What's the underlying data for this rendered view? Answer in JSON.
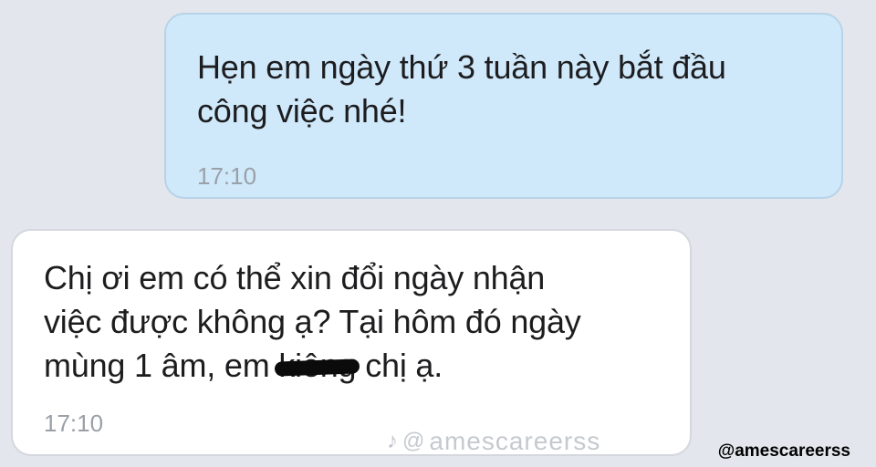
{
  "messages": [
    {
      "direction": "sent",
      "lines": [
        "Hẹn em ngày thứ 3 tuần này bắt đầu",
        "công việc nhé!"
      ],
      "time": "17:10"
    },
    {
      "direction": "received",
      "lines": [
        "Chị ơi em có thể xin đổi ngày nhận",
        "việc được không ạ? Tại hôm đó ngày"
      ],
      "line3_before": "mùng 1 âm, em ",
      "line3_struck": "kiêng",
      "line3_after": " chị ạ.",
      "time": "17:10"
    }
  ],
  "watermark": {
    "icon": "tiktok-icon",
    "at": "@",
    "text": "amescareerss"
  },
  "handle": "@amescareerss",
  "colors": {
    "background": "#e3e6ec",
    "sent_bubble": "#cfe9fb",
    "received_bubble": "#ffffff",
    "timestamp": "#9aa0a8"
  }
}
